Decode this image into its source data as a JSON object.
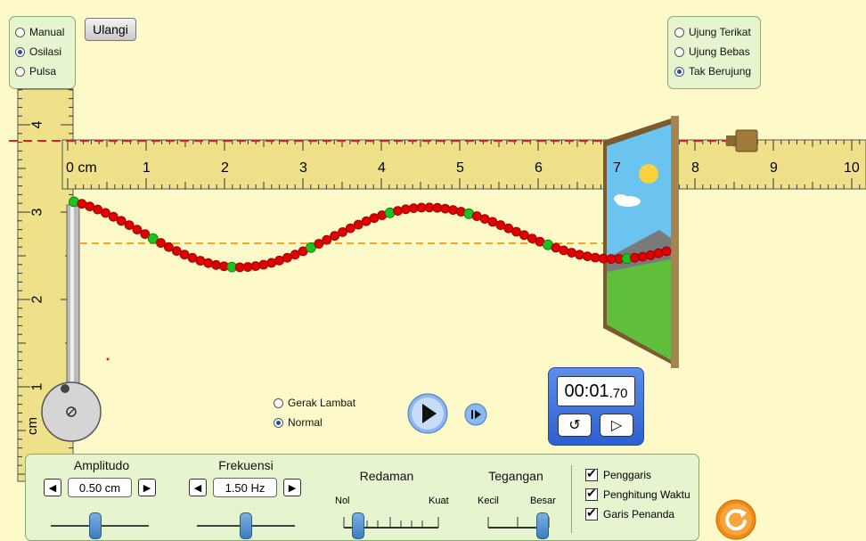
{
  "mode": {
    "options": [
      {
        "label": "Manual",
        "selected": false
      },
      {
        "label": "Osilasi",
        "selected": true
      },
      {
        "label": "Pulsa",
        "selected": false
      }
    ]
  },
  "reset_button": "Ulangi",
  "end": {
    "options": [
      {
        "label": "Ujung Terikat",
        "selected": false
      },
      {
        "label": "Ujung Bebas",
        "selected": false
      },
      {
        "label": "Tak Berujung",
        "selected": true
      }
    ]
  },
  "ruler": {
    "h_start_label": "0 cm",
    "h_ticks": [
      "1",
      "2",
      "3",
      "4",
      "5",
      "6",
      "7",
      "8",
      "9",
      "10"
    ],
    "v_ticks": [
      "4",
      "3",
      "2",
      "1"
    ],
    "v_unit": "cm"
  },
  "speed": {
    "options": [
      {
        "label": "Gerak Lambat",
        "selected": false
      },
      {
        "label": "Normal",
        "selected": true
      }
    ]
  },
  "timer": {
    "value_main": "00:01",
    "value_frac": ".70"
  },
  "controls": {
    "amplitude": {
      "title": "Amplitudo",
      "value": "0.50 cm",
      "level": 0.45
    },
    "frequency": {
      "title": "Frekuensi",
      "value": "1.50 Hz",
      "level": 0.5
    },
    "damping": {
      "title": "Redaman",
      "min_label": "Nol",
      "max_label": "Kuat",
      "level": 0.1
    },
    "tension": {
      "title": "Tegangan",
      "min_label": "Kecil",
      "max_label": "Besar",
      "level": 1.0
    }
  },
  "toggles": [
    {
      "label": "Penggaris",
      "checked": true
    },
    {
      "label": "Penghitung Waktu",
      "checked": true
    },
    {
      "label": "Garis Penanda",
      "checked": true
    }
  ],
  "colors": {
    "bead": "#e00000",
    "bead_marker": "#1ec21e",
    "ruler": "#efe08a",
    "ref_line_red": "#e02020",
    "ref_line_orange": "#f5a623"
  }
}
